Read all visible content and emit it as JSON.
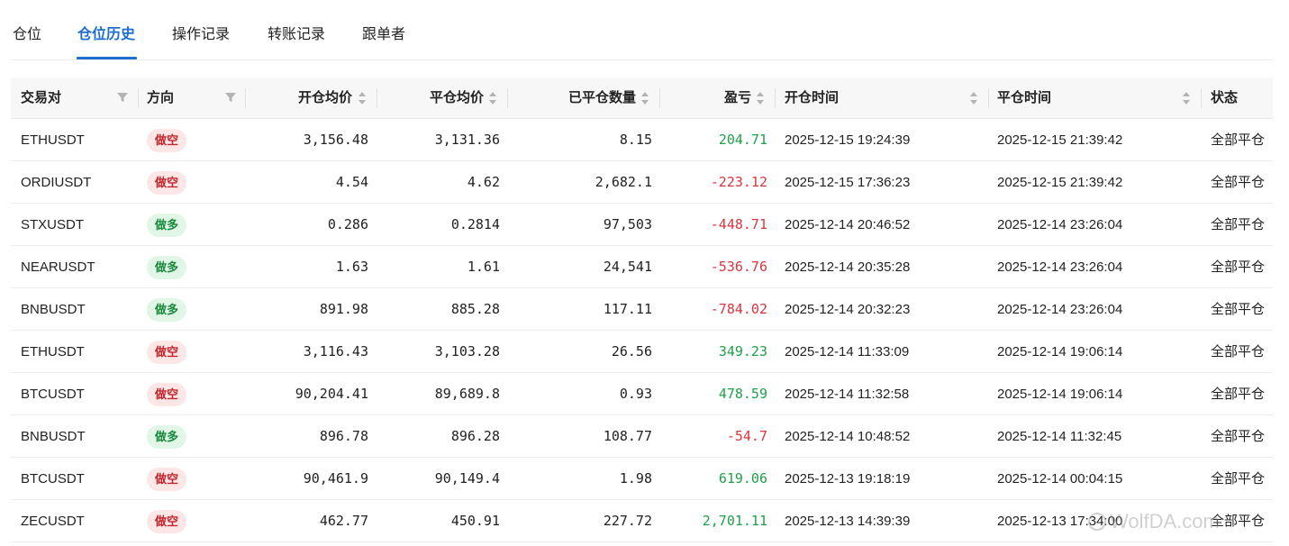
{
  "tabs": [
    {
      "label": "仓位",
      "active": false
    },
    {
      "label": "仓位历史",
      "active": true
    },
    {
      "label": "操作记录",
      "active": false
    },
    {
      "label": "转账记录",
      "active": false
    },
    {
      "label": "跟单者",
      "active": false
    }
  ],
  "table": {
    "columns": {
      "pair": "交易对",
      "direction": "方向",
      "open_avg": "开仓均价",
      "close_avg": "平仓均价",
      "closed_qty": "已平仓数量",
      "pnl": "盈亏",
      "open_time": "开仓时间",
      "close_time": "平仓时间",
      "status": "状态"
    },
    "rows": [
      {
        "pair": "ETHUSDT",
        "direction": "做空",
        "side": "short",
        "open_avg": "3,156.48",
        "close_avg": "3,131.36",
        "closed_qty": "8.15",
        "pnl": "204.71",
        "pnl_sign": "pos",
        "open_time": "2025-12-15 19:24:39",
        "close_time": "2025-12-15 21:39:42",
        "status": "全部平仓"
      },
      {
        "pair": "ORDIUSDT",
        "direction": "做空",
        "side": "short",
        "open_avg": "4.54",
        "close_avg": "4.62",
        "closed_qty": "2,682.1",
        "pnl": "-223.12",
        "pnl_sign": "neg",
        "open_time": "2025-12-15 17:36:23",
        "close_time": "2025-12-15 21:39:42",
        "status": "全部平仓"
      },
      {
        "pair": "STXUSDT",
        "direction": "做多",
        "side": "long",
        "open_avg": "0.286",
        "close_avg": "0.2814",
        "closed_qty": "97,503",
        "pnl": "-448.71",
        "pnl_sign": "neg",
        "open_time": "2025-12-14 20:46:52",
        "close_time": "2025-12-14 23:26:04",
        "status": "全部平仓"
      },
      {
        "pair": "NEARUSDT",
        "direction": "做多",
        "side": "long",
        "open_avg": "1.63",
        "close_avg": "1.61",
        "closed_qty": "24,541",
        "pnl": "-536.76",
        "pnl_sign": "neg",
        "open_time": "2025-12-14 20:35:28",
        "close_time": "2025-12-14 23:26:04",
        "status": "全部平仓"
      },
      {
        "pair": "BNBUSDT",
        "direction": "做多",
        "side": "long",
        "open_avg": "891.98",
        "close_avg": "885.28",
        "closed_qty": "117.11",
        "pnl": "-784.02",
        "pnl_sign": "neg",
        "open_time": "2025-12-14 20:32:23",
        "close_time": "2025-12-14 23:26:04",
        "status": "全部平仓"
      },
      {
        "pair": "ETHUSDT",
        "direction": "做空",
        "side": "short",
        "open_avg": "3,116.43",
        "close_avg": "3,103.28",
        "closed_qty": "26.56",
        "pnl": "349.23",
        "pnl_sign": "pos",
        "open_time": "2025-12-14 11:33:09",
        "close_time": "2025-12-14 19:06:14",
        "status": "全部平仓"
      },
      {
        "pair": "BTCUSDT",
        "direction": "做空",
        "side": "short",
        "open_avg": "90,204.41",
        "close_avg": "89,689.8",
        "closed_qty": "0.93",
        "pnl": "478.59",
        "pnl_sign": "pos",
        "open_time": "2025-12-14 11:32:58",
        "close_time": "2025-12-14 19:06:14",
        "status": "全部平仓"
      },
      {
        "pair": "BNBUSDT",
        "direction": "做多",
        "side": "long",
        "open_avg": "896.78",
        "close_avg": "896.28",
        "closed_qty": "108.77",
        "pnl": "-54.7",
        "pnl_sign": "neg",
        "open_time": "2025-12-14 10:48:52",
        "close_time": "2025-12-14 11:32:45",
        "status": "全部平仓"
      },
      {
        "pair": "BTCUSDT",
        "direction": "做空",
        "side": "short",
        "open_avg": "90,461.9",
        "close_avg": "90,149.4",
        "closed_qty": "1.98",
        "pnl": "619.06",
        "pnl_sign": "pos",
        "open_time": "2025-12-13 19:18:19",
        "close_time": "2025-12-14 00:04:15",
        "status": "全部平仓"
      },
      {
        "pair": "ZECUSDT",
        "direction": "做空",
        "side": "short",
        "open_avg": "462.77",
        "close_avg": "450.91",
        "closed_qty": "227.72",
        "pnl": "2,701.11",
        "pnl_sign": "pos",
        "open_time": "2025-12-13 14:39:39",
        "close_time": "2025-12-13 17:34:00",
        "status": "全部平仓"
      }
    ]
  },
  "watermark": "WolfDA.com",
  "colors": {
    "accent": "#1f6fd1",
    "profit": "#1fa04a",
    "loss": "#d9363e"
  }
}
